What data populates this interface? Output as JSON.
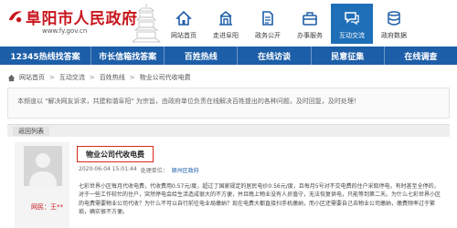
{
  "header": {
    "site_title": "阜阳市人民政府",
    "site_url": "www.fy.gov.cn",
    "nav_icons": [
      {
        "label": "网站首页",
        "icon": "home-icon",
        "active": false
      },
      {
        "label": "走进阜阳",
        "icon": "building-icon",
        "active": false
      },
      {
        "label": "政务公开",
        "icon": "document-icon",
        "active": false
      },
      {
        "label": "办事服务",
        "icon": "briefcase-icon",
        "active": false
      },
      {
        "label": "互动交流",
        "icon": "chat-icon",
        "active": true
      },
      {
        "label": "政府数据",
        "icon": "database-icon",
        "active": false
      }
    ]
  },
  "navbar": {
    "items": [
      "12345热线找答案",
      "市长信箱找答案",
      "百姓热线",
      "在线访谈",
      "民意征集",
      "在线调查"
    ]
  },
  "breadcrumb": {
    "items": [
      "网站首页",
      "互动交流",
      "百姓热线",
      "物业公司代收电费"
    ]
  },
  "notice": {
    "text": "本频道以 \"解决网友诉求，共建和谐阜阳\" 为宗旨，由政府单位负责在线解决百姓提出的各种问题，及时回复，及时处理！"
  },
  "back_label": "返回列表",
  "post": {
    "author": "网民：王**",
    "title": "物业公司代收电费",
    "date": "2020-06-04 15:01:44",
    "unit_prefix": "处理单位：",
    "unit": "颍州区政府",
    "body": "七彩世界小区每月代收电费，代收费用0.57元/度，超过了国家规定的居民电价0.56元/度，且每月5号对不交电费的住户采取停电，有时甚至全停的，对于一些工作较忙的住户，突然停电会给生活造成很大的不方便，并且晚上物业没有人员值守，无法恢复供电，只能等到第二天。为什么七彩世界小区的电费需要物业公司代收？为什么不可以自行前往电业局缴纳？现在电费大都直接扫手机缴纳，而小区还需要自己去物业公司缴纳，缴费频率过于繁琐，确实很不方便。"
  }
}
